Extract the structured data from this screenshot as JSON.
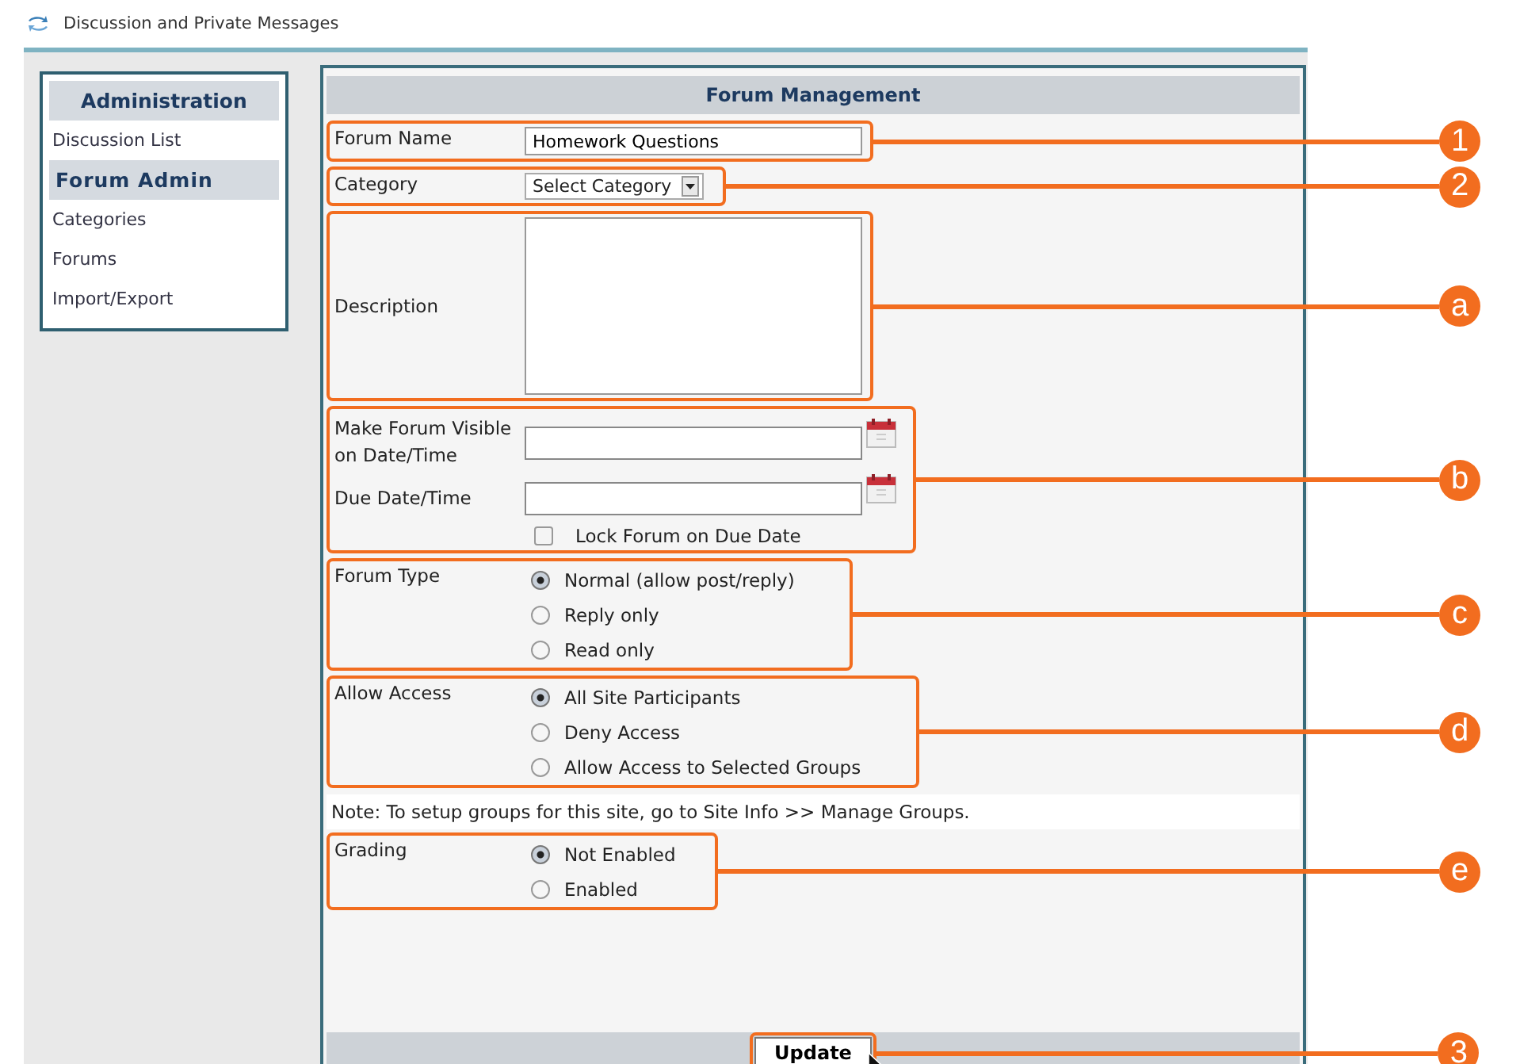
{
  "header": {
    "title": "Discussion and Private Messages"
  },
  "sidebar": {
    "sections": [
      {
        "heading": "Administration",
        "items": [
          "Discussion List"
        ]
      },
      {
        "heading": "Forum Admin",
        "items": [
          "Categories",
          "Forums",
          "Import/Export"
        ]
      }
    ]
  },
  "form": {
    "title": "Forum Management",
    "groups": [
      {
        "kind": "text",
        "callout": "1",
        "label": "Forum Name",
        "value": "Homework Questions"
      },
      {
        "kind": "select",
        "callout": "2",
        "label": "Category",
        "value": "Select Category"
      },
      {
        "kind": "textarea",
        "callout": "a",
        "label": "Description"
      },
      {
        "kind": "dates",
        "callout": "b",
        "fields": [
          {
            "label": "Make Forum Visible on Date/Time"
          },
          {
            "label": "Due Date/Time"
          }
        ],
        "checkbox": {
          "label": "Lock Forum on Due Date",
          "checked": false
        }
      },
      {
        "kind": "radios",
        "callout": "c",
        "label": "Forum Type",
        "options": [
          {
            "label": "Normal (allow post/reply)",
            "selected": true
          },
          {
            "label": "Reply only",
            "selected": false
          },
          {
            "label": "Read only",
            "selected": false
          }
        ]
      },
      {
        "kind": "radios",
        "callout": "d",
        "label": "Allow Access",
        "options": [
          {
            "label": "All Site Participants",
            "selected": true
          },
          {
            "label": "Deny Access",
            "selected": false
          },
          {
            "label": "Allow Access to Selected Groups",
            "selected": false
          }
        ]
      },
      {
        "kind": "note",
        "text": "Note: To setup groups for this site, go to Site Info >> Manage Groups."
      },
      {
        "kind": "radios",
        "callout": "e",
        "label": "Grading",
        "options": [
          {
            "label": "Not Enabled",
            "selected": true
          },
          {
            "label": "Enabled",
            "selected": false
          }
        ]
      }
    ],
    "button": {
      "label": "Update",
      "callout": "3"
    }
  }
}
